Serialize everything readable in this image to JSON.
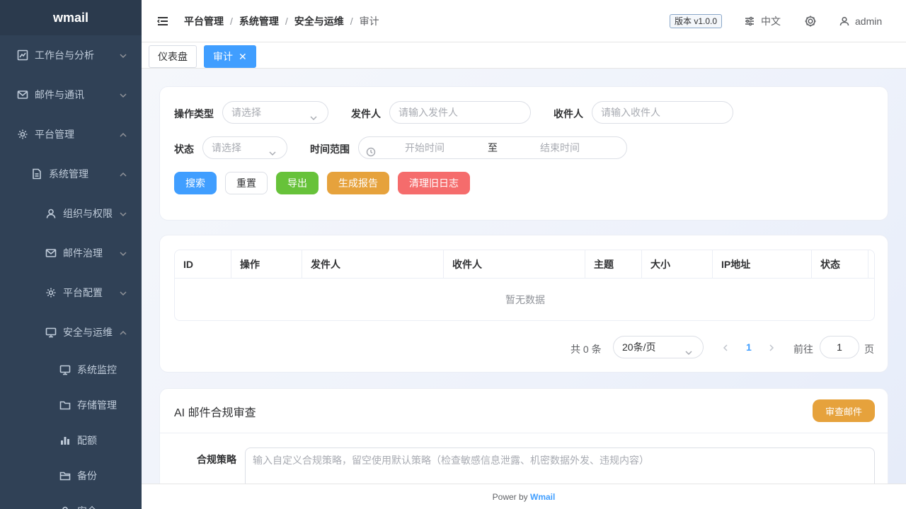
{
  "app": {
    "logo": "wmail"
  },
  "sidebar": {
    "items": [
      {
        "label": "工作台与分析",
        "icon": "chart-line-icon",
        "expanded": false
      },
      {
        "label": "邮件与通讯",
        "icon": "mail-icon",
        "expanded": false
      },
      {
        "label": "平台管理",
        "icon": "gear-icon",
        "expanded": true
      },
      {
        "label": "系统管理",
        "icon": "document-icon",
        "expanded": true
      },
      {
        "label": "组织与权限",
        "icon": "user-icon",
        "expanded": false
      },
      {
        "label": "邮件治理",
        "icon": "mail-icon",
        "expanded": false
      },
      {
        "label": "平台配置",
        "icon": "gear-icon",
        "expanded": false
      },
      {
        "label": "安全与运维",
        "icon": "monitor-icon",
        "expanded": true
      },
      {
        "label": "系统监控",
        "icon": "monitor-icon"
      },
      {
        "label": "存储管理",
        "icon": "folder-icon"
      },
      {
        "label": "配额",
        "icon": "bar-chart-icon"
      },
      {
        "label": "备份",
        "icon": "folder-open-icon"
      },
      {
        "label": "安全",
        "icon": "user-icon"
      }
    ]
  },
  "header": {
    "breadcrumb": [
      "平台管理",
      "系统管理",
      "安全与运维",
      "审计"
    ],
    "version": "版本 v1.0.0",
    "language": "中文",
    "user": "admin"
  },
  "tags": [
    {
      "label": "仪表盘",
      "active": false
    },
    {
      "label": "审计",
      "active": true
    }
  ],
  "filters": {
    "op_type_label": "操作类型",
    "op_type_placeholder": "请选择",
    "sender_label": "发件人",
    "sender_placeholder": "请输入发件人",
    "recipient_label": "收件人",
    "recipient_placeholder": "请输入收件人",
    "status_label": "状态",
    "status_placeholder": "请选择",
    "time_label": "时间范围",
    "time_start": "开始时间",
    "time_sep": "至",
    "time_end": "结束时间"
  },
  "actions": {
    "search": "搜索",
    "reset": "重置",
    "export": "导出",
    "report": "生成报告",
    "clean": "清理旧日志"
  },
  "colors": {
    "primary": "#409eff",
    "success": "#67c23a",
    "warning": "#e6a23c",
    "danger": "#f56c6c",
    "sidebar_bg": "#304156"
  },
  "table": {
    "columns": [
      "ID",
      "操作",
      "发件人",
      "收件人",
      "主题",
      "大小",
      "IP地址",
      "状态"
    ],
    "empty_text": "暂无数据"
  },
  "pagination": {
    "total": "共 0 条",
    "page_size": "20条/页",
    "current_page": "1",
    "goto_label": "前往",
    "goto_value": "1",
    "page_suffix": "页"
  },
  "ai": {
    "title": "AI 邮件合规审查",
    "review_button": "审查邮件",
    "policy_label": "合规策略",
    "policy_placeholder": "输入自定义合规策略，留空使用默认策略（检查敏感信息泄露、机密数据外发、违规内容）"
  },
  "footer": {
    "prefix": "Power by",
    "brand": "Wmail"
  }
}
